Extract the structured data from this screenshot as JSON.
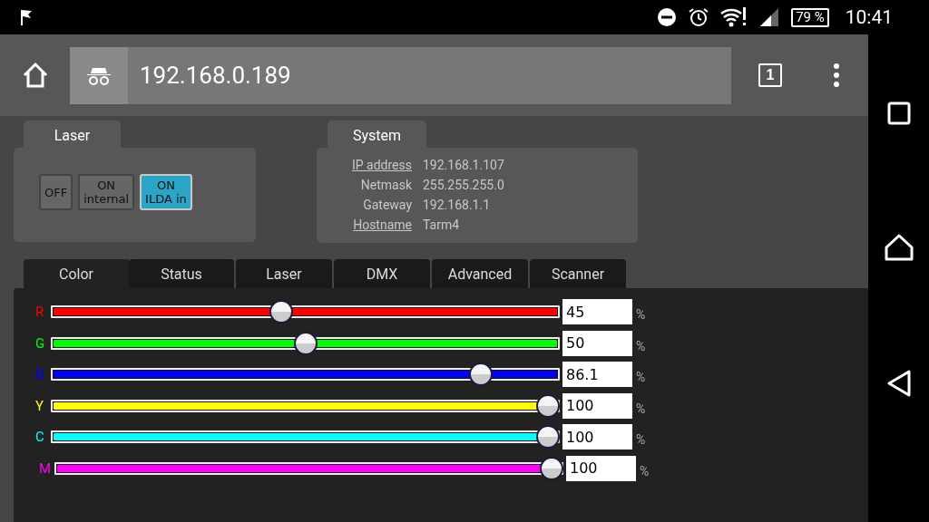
{
  "status_bar": {
    "battery": "79 %",
    "time": "10:41"
  },
  "browser": {
    "url": "192.168.0.189",
    "tab_count": "1"
  },
  "laser_panel": {
    "title": "Laser",
    "buttons": [
      {
        "label": "OFF",
        "selected": false
      },
      {
        "label": "ON internal",
        "selected": false
      },
      {
        "label": "ON ILDA in",
        "selected": true
      }
    ]
  },
  "system_panel": {
    "title": "System",
    "rows": [
      {
        "label": "IP address",
        "value": "192.168.1.107",
        "link": true
      },
      {
        "label": "Netmask",
        "value": "255.255.255.0",
        "link": false
      },
      {
        "label": "Gateway",
        "value": "192.168.1.1",
        "link": false
      },
      {
        "label": "Hostname",
        "value": "Tarm4",
        "link": true
      }
    ]
  },
  "tabs": [
    {
      "label": "Color",
      "selected": true
    },
    {
      "label": "Status",
      "selected": false
    },
    {
      "label": "Laser",
      "selected": false
    },
    {
      "label": "DMX",
      "selected": false
    },
    {
      "label": "Advanced",
      "selected": false
    },
    {
      "label": "Scanner",
      "selected": false
    }
  ],
  "channels": [
    {
      "name": "R",
      "color": "#ff0000",
      "level": 0.45,
      "value": "45",
      "unit": "%"
    },
    {
      "name": "G",
      "color": "#00ff00",
      "level": 0.5,
      "value": "50",
      "unit": "%"
    },
    {
      "name": "B",
      "color": "#0000ff",
      "level": 0.861,
      "value": "86.1",
      "unit": "%"
    },
    {
      "name": "Y",
      "color": "#ffff00",
      "level": 1,
      "value": "100",
      "unit": "%"
    },
    {
      "name": "C",
      "color": "#00ffff",
      "level": 1,
      "value": "100",
      "unit": "%"
    },
    {
      "name": "M",
      "color": "#ff00ff",
      "level": 1,
      "value": "100",
      "unit": "%"
    }
  ]
}
